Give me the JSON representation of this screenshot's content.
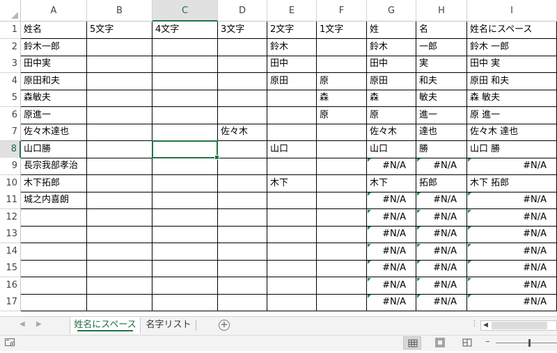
{
  "columns": [
    "A",
    "B",
    "C",
    "D",
    "E",
    "F",
    "G",
    "H",
    "I"
  ],
  "active_column": "C",
  "row_numbers": [
    "1",
    "2",
    "3",
    "4",
    "5",
    "6",
    "7",
    "8",
    "9",
    "10",
    "11",
    "12",
    "13",
    "14",
    "15",
    "16",
    "17"
  ],
  "active_row": "8",
  "rows": [
    [
      "姓名",
      "5文字",
      "4文字",
      "3文字",
      "2文字",
      "1文字",
      "姓",
      "名",
      "姓名にスペース"
    ],
    [
      "鈴木一郎",
      "",
      "",
      "",
      "鈴木",
      "",
      "鈴木",
      "一郎",
      "鈴木 一郎"
    ],
    [
      "田中実",
      "",
      "",
      "",
      "田中",
      "",
      "田中",
      "実",
      "田中 実"
    ],
    [
      "原田和夫",
      "",
      "",
      "",
      "原田",
      "原",
      "原田",
      "和夫",
      "原田 和夫"
    ],
    [
      "森敏夫",
      "",
      "",
      "",
      "",
      "森",
      "森",
      "敏夫",
      "森 敏夫"
    ],
    [
      "原進一",
      "",
      "",
      "",
      "",
      "原",
      "原",
      "進一",
      "原 進一"
    ],
    [
      "佐々木達也",
      "",
      "",
      "佐々木",
      "",
      "",
      "佐々木",
      "達也",
      "佐々木 達也"
    ],
    [
      "山口勝",
      "",
      "",
      "",
      "山口",
      "",
      "山口",
      "勝",
      "山口 勝"
    ],
    [
      "長宗我部孝治",
      "",
      "",
      "",
      "",
      "",
      "#N/A",
      "#N/A",
      "#N/A"
    ],
    [
      "木下拓郎",
      "",
      "",
      "",
      "木下",
      "",
      "木下",
      "拓郎",
      "木下 拓郎"
    ],
    [
      "城之内喜朗",
      "",
      "",
      "",
      "",
      "",
      "#N/A",
      "#N/A",
      "#N/A"
    ],
    [
      "",
      "",
      "",
      "",
      "",
      "",
      "#N/A",
      "#N/A",
      "#N/A"
    ],
    [
      "",
      "",
      "",
      "",
      "",
      "",
      "#N/A",
      "#N/A",
      "#N/A"
    ],
    [
      "",
      "",
      "",
      "",
      "",
      "",
      "#N/A",
      "#N/A",
      "#N/A"
    ],
    [
      "",
      "",
      "",
      "",
      "",
      "",
      "#N/A",
      "#N/A",
      "#N/A"
    ],
    [
      "",
      "",
      "",
      "",
      "",
      "",
      "#N/A",
      "#N/A",
      "#N/A"
    ],
    [
      "",
      "",
      "",
      "",
      "",
      "",
      "#N/A",
      "#N/A",
      "#N/A"
    ]
  ],
  "sheet_tabs": [
    {
      "label": "姓名にスペース",
      "active": true
    },
    {
      "label": "名字リスト",
      "active": false
    }
  ],
  "add_sheet_label": "+",
  "tab_overflow_dots": "⋮",
  "icons": {
    "nav_prev": "triangle-left-icon",
    "nav_next": "triangle-right-icon",
    "macro_record": "macro-record-icon",
    "view_normal": "normal-view-icon",
    "view_page_layout": "page-layout-icon",
    "view_page_break": "page-break-preview-icon"
  },
  "colors": {
    "accent": "#217346",
    "error_triangle": "#1f8a3c",
    "cell_border": "#000000"
  }
}
